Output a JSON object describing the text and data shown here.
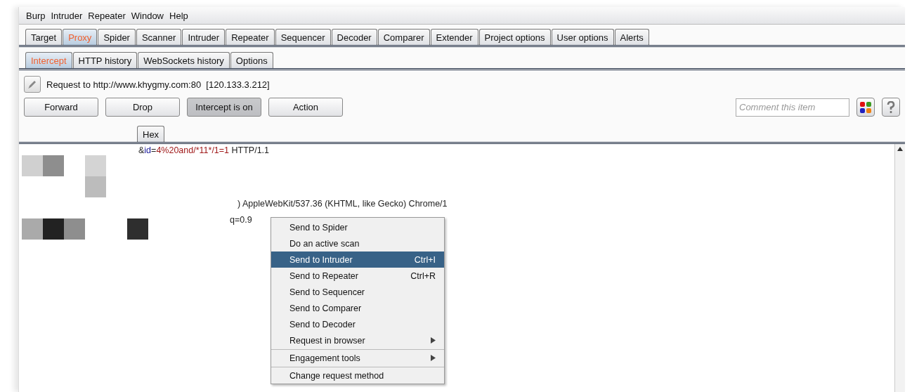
{
  "menu_bar": [
    "Burp",
    "Intruder",
    "Repeater",
    "Window",
    "Help"
  ],
  "tabs": [
    {
      "label": "Target",
      "selected": false
    },
    {
      "label": "Proxy",
      "selected": true
    },
    {
      "label": "Spider",
      "selected": false
    },
    {
      "label": "Scanner",
      "selected": false
    },
    {
      "label": "Intruder",
      "selected": false
    },
    {
      "label": "Repeater",
      "selected": false
    },
    {
      "label": "Sequencer",
      "selected": false
    },
    {
      "label": "Decoder",
      "selected": false
    },
    {
      "label": "Comparer",
      "selected": false
    },
    {
      "label": "Extender",
      "selected": false
    },
    {
      "label": "Project options",
      "selected": false
    },
    {
      "label": "User options",
      "selected": false
    },
    {
      "label": "Alerts",
      "selected": false
    }
  ],
  "sub_tabs": [
    {
      "label": "Intercept",
      "selected": true
    },
    {
      "label": "HTTP history",
      "selected": false
    },
    {
      "label": "WebSockets history",
      "selected": false
    },
    {
      "label": "Options",
      "selected": false
    }
  ],
  "request_info": "Request to http://www.khygmy.com:80  [120.133.3.212]",
  "buttons": [
    {
      "label": "Forward",
      "pressed": false
    },
    {
      "label": "Drop",
      "pressed": false
    },
    {
      "label": "Intercept is on",
      "pressed": true
    },
    {
      "label": "Action",
      "pressed": false
    }
  ],
  "comment": {
    "placeholder": "Comment this item"
  },
  "editor_tabs": [
    {
      "label": "Hex",
      "selected": false
    }
  ],
  "editor_lines": [
    {
      "parts": [
        {
          "text": "&",
          "kind": "plain"
        },
        {
          "text": "id",
          "kind": "name"
        },
        {
          "text": "=",
          "kind": "plain"
        },
        {
          "text": "4%20and/*11*/1=1",
          "kind": "value"
        },
        {
          "text": " HTTP/1.1",
          "kind": "plain"
        }
      ]
    },
    {
      "parts": [
        {
          "text": ") AppleWebKit/537.36 (KHTML, like Gecko) Chrome/1",
          "kind": "plain"
        }
      ]
    },
    {
      "parts": [
        {
          "text": "q=0.9",
          "kind": "plain"
        }
      ]
    }
  ],
  "context_menu": [
    {
      "label": "Send to Spider",
      "selected": false
    },
    {
      "label": "Do an active scan",
      "selected": false
    },
    {
      "label": "Send to Intruder",
      "shortcut": "Ctrl+I",
      "selected": true
    },
    {
      "label": "Send to Repeater",
      "shortcut": "Ctrl+R",
      "selected": false
    },
    {
      "label": "Send to Sequencer",
      "selected": false
    },
    {
      "label": "Send to Comparer",
      "selected": false
    },
    {
      "label": "Send to Decoder",
      "selected": false
    },
    {
      "label": "Request in browser",
      "submenu": true,
      "selected": false
    },
    {
      "label": "Engagement tools",
      "submenu": true,
      "separator_before": true,
      "selected": false
    },
    {
      "label": "Change request method",
      "separator_before": true,
      "selected": false
    }
  ]
}
